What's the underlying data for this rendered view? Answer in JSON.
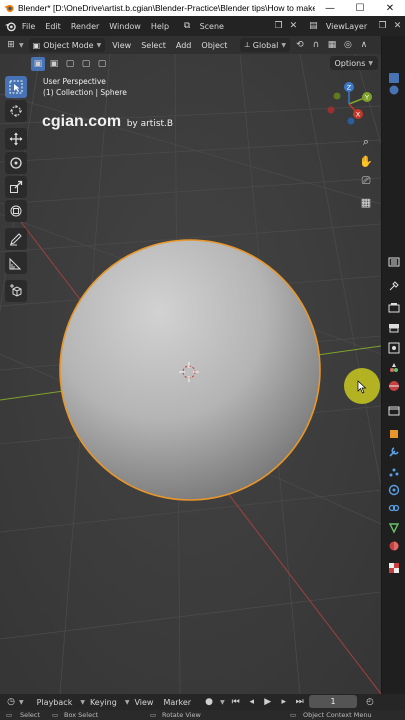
{
  "window": {
    "title": "Blender* [D:\\OneDrive\\artist.b.cgian\\Blender-Practice\\Blender tips\\How to make ...",
    "minimize": "—",
    "maximize": "☐",
    "close": "✕"
  },
  "topmenu": {
    "items": [
      "File",
      "Edit",
      "Render",
      "Window",
      "Help"
    ],
    "scene_label": "Scene",
    "viewlayer_label": "ViewLayer"
  },
  "viewport_header": {
    "mode": "Object Mode",
    "menus": [
      "View",
      "Select",
      "Add",
      "Object"
    ],
    "orientation": "Global"
  },
  "tool_header": {
    "options_label": "Options"
  },
  "viewport": {
    "view_name": "User Perspective",
    "collection_info": "(1) Collection | Sphere",
    "watermark_main": "cgian.com",
    "watermark_sub": "by artist.B",
    "gizmo": {
      "x": "X",
      "y": "Y",
      "z": "Z"
    }
  },
  "timeline": {
    "menus": [
      "Playback",
      "Keying",
      "View",
      "Marker"
    ],
    "current_frame": "1"
  },
  "statusbar": {
    "select": "Select",
    "box_select": "Box Select",
    "rotate_view": "Rotate View",
    "context_menu": "Object Context Menu"
  },
  "colors": {
    "active_tool": "#4772b3",
    "selection_outline": "#e8962a",
    "axis_x": "#c0392b",
    "axis_y": "#7fa32b",
    "cursor_highlight": "#c8c81e"
  }
}
